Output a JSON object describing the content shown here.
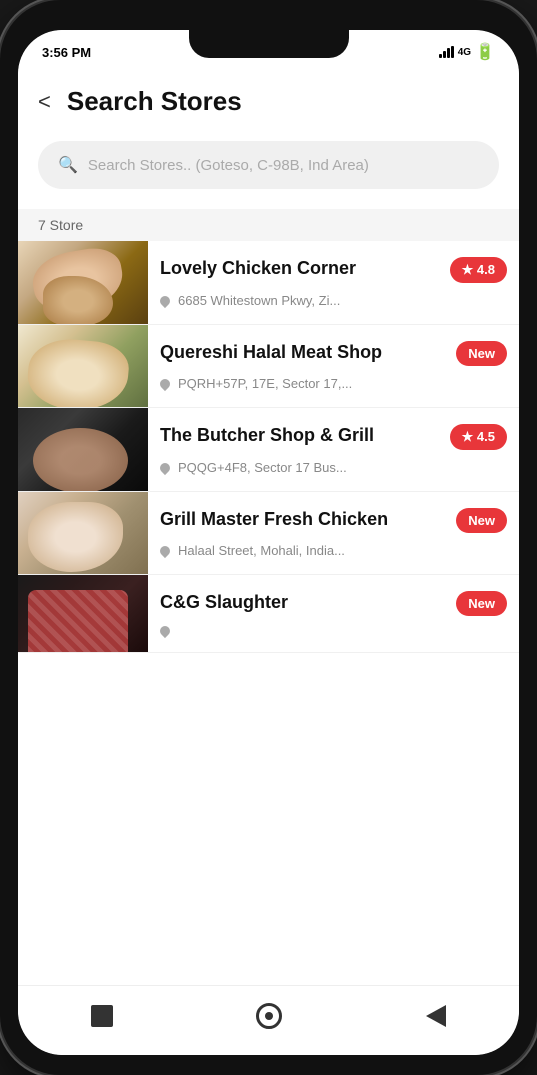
{
  "status": {
    "time": "3:56 PM"
  },
  "header": {
    "title": "Search Stores",
    "back_label": "<"
  },
  "search": {
    "placeholder": "Search Stores.. (Goteso, C-98B, Ind Area)"
  },
  "store_count": {
    "label": "7 Store"
  },
  "stores": [
    {
      "id": 1,
      "name": "Lovely Chicken Corner",
      "address": "6685 Whitestown Pkwy, Zi...",
      "badge": "★ 4.8",
      "image_type": "chicken"
    },
    {
      "id": 2,
      "name": "Quereshi Halal Meat Shop",
      "address": "PQRH+57P, 17E, Sector 17,...",
      "badge": "New",
      "image_type": "halal"
    },
    {
      "id": 3,
      "name": "The Butcher Shop & Grill",
      "address": "PQQG+4F8, Sector 17 Bus...",
      "badge": "★ 4.5",
      "image_type": "butcher"
    },
    {
      "id": 4,
      "name": "Grill Master Fresh Chicken",
      "address": "Halaal Street, Mohali, India...",
      "badge": "New",
      "image_type": "grill"
    },
    {
      "id": 5,
      "name": "C&G Slaughter",
      "address": "",
      "badge": "New",
      "image_type": "slaughter"
    }
  ],
  "nav": {
    "stop_label": "stop",
    "home_label": "home",
    "back_label": "back"
  },
  "colors": {
    "accent": "#e8363a",
    "badge_bg": "#e8363a",
    "text_primary": "#111111",
    "text_secondary": "#888888"
  }
}
